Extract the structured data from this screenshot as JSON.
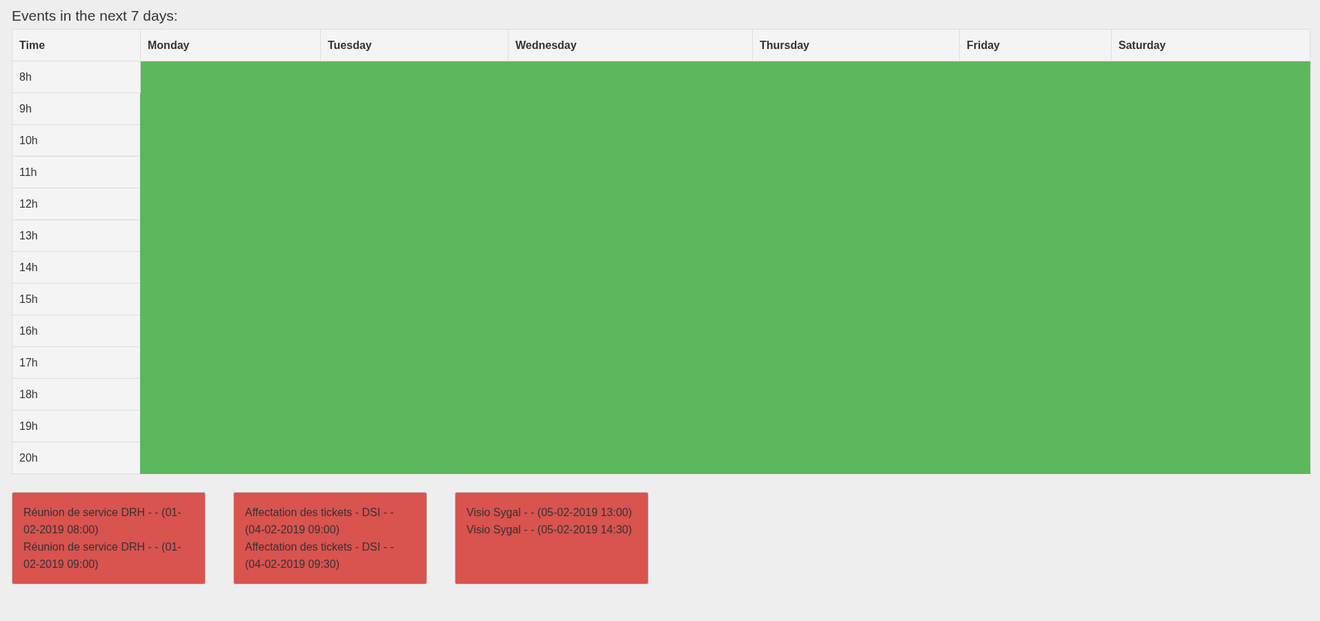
{
  "heading": "Events in the next 7 days:",
  "table": {
    "columns": [
      "Time",
      "Monday",
      "Tuesday",
      "Wednesday",
      "Thursday",
      "Friday",
      "Saturday"
    ],
    "rows": [
      "8h",
      "9h",
      "10h",
      "11h",
      "12h",
      "13h",
      "14h",
      "15h",
      "16h",
      "17h",
      "18h",
      "19h",
      "20h"
    ]
  },
  "event_cards": [
    {
      "events": [
        "Réunion de service DRH - - (01-02-2019 08:00)",
        "Réunion de service DRH - - (01-02-2019 09:00)"
      ]
    },
    {
      "events": [
        "Affectation des tickets - DSI - - (04-02-2019 09:00)",
        "Affectation des tickets - DSI - - (04-02-2019 09:30)"
      ]
    },
    {
      "events": [
        "Visio Sygal - - (05-02-2019 13:00)",
        "Visio Sygal - - (05-02-2019 14:30)"
      ]
    }
  ]
}
